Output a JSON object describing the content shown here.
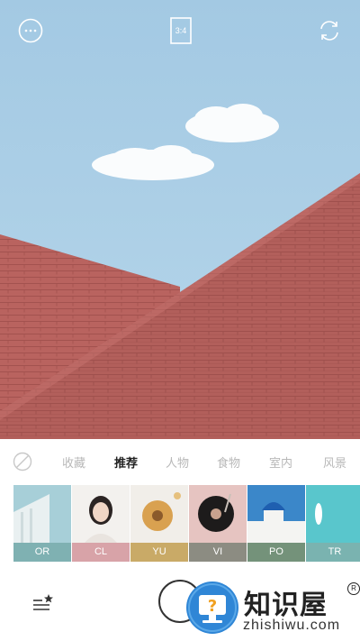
{
  "toolbar": {
    "ratio_label": "3:4",
    "more_icon": "more-dots-icon",
    "flip_icon": "camera-flip-icon"
  },
  "categories": {
    "none_icon": "no-filter-icon",
    "items": [
      {
        "label": "收藏",
        "active": false
      },
      {
        "label": "推荐",
        "active": true
      },
      {
        "label": "人物",
        "active": false
      },
      {
        "label": "食物",
        "active": false
      },
      {
        "label": "室内",
        "active": false
      },
      {
        "label": "风景",
        "active": false
      }
    ]
  },
  "filters": [
    {
      "label": "OR",
      "color": "#7fb1b2"
    },
    {
      "label": "CL",
      "color": "#d8a3a8"
    },
    {
      "label": "YU",
      "color": "#c9aa67"
    },
    {
      "label": "VI",
      "color": "#8c8c82"
    },
    {
      "label": "PO",
      "color": "#74927a"
    },
    {
      "label": "TR",
      "color": "#7ab3b0"
    }
  ],
  "bottom": {
    "menu_icon": "filter-menu-star-icon",
    "shutter": "shutter-button"
  },
  "watermark": {
    "title": "知识屋",
    "url": "zhishiwu.com",
    "reg": "R"
  },
  "colors": {
    "sky": "#a9cde6",
    "brick": "#b4625e",
    "active_text": "#222222",
    "inactive_text": "#b8b8b8"
  }
}
